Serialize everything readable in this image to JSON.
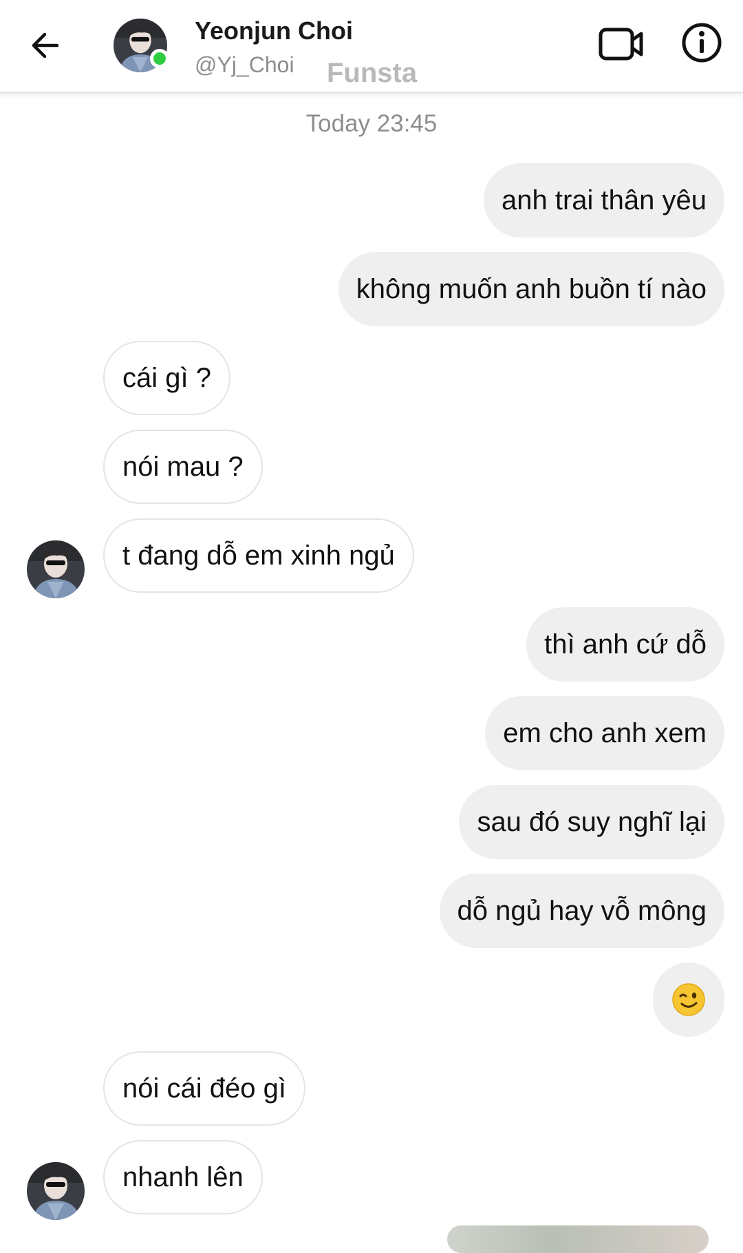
{
  "header": {
    "contact_name": "Yeonjun Choi",
    "contact_handle": "@Yj_Choi",
    "watermark": "Funsta",
    "online_status_color": "#2ecc40",
    "icons": [
      "back-arrow-icon",
      "video-call-icon",
      "info-icon"
    ]
  },
  "conversation": {
    "timestamp": "Today 23:45",
    "messages": [
      {
        "direction": "outgoing",
        "text": "anh trai thân yêu"
      },
      {
        "direction": "outgoing",
        "text": "không muốn anh buồn tí nào"
      },
      {
        "direction": "incoming",
        "text": "cái gì ?"
      },
      {
        "direction": "incoming",
        "text": "nói mau ?"
      },
      {
        "direction": "incoming",
        "text": "t đang dỗ em xinh ngủ",
        "shows_avatar": true
      },
      {
        "direction": "outgoing",
        "text": "thì anh cứ dỗ"
      },
      {
        "direction": "outgoing",
        "text": "em cho anh xem"
      },
      {
        "direction": "outgoing",
        "text": "sau đó suy nghĩ lại"
      },
      {
        "direction": "outgoing",
        "text": "dỗ ngủ hay vỗ mông"
      },
      {
        "direction": "outgoing",
        "emoji": "winking-face-emoji"
      },
      {
        "direction": "incoming",
        "text": "nói cái đéo gì"
      },
      {
        "direction": "incoming",
        "text": "nhanh lên",
        "shows_avatar": true
      }
    ]
  },
  "colors": {
    "outgoing_bubble": "#efefef",
    "incoming_bubble_border": "#e4e4e4",
    "secondary_text": "#8e8e8e",
    "watermark_text": "#b9b9b9"
  }
}
